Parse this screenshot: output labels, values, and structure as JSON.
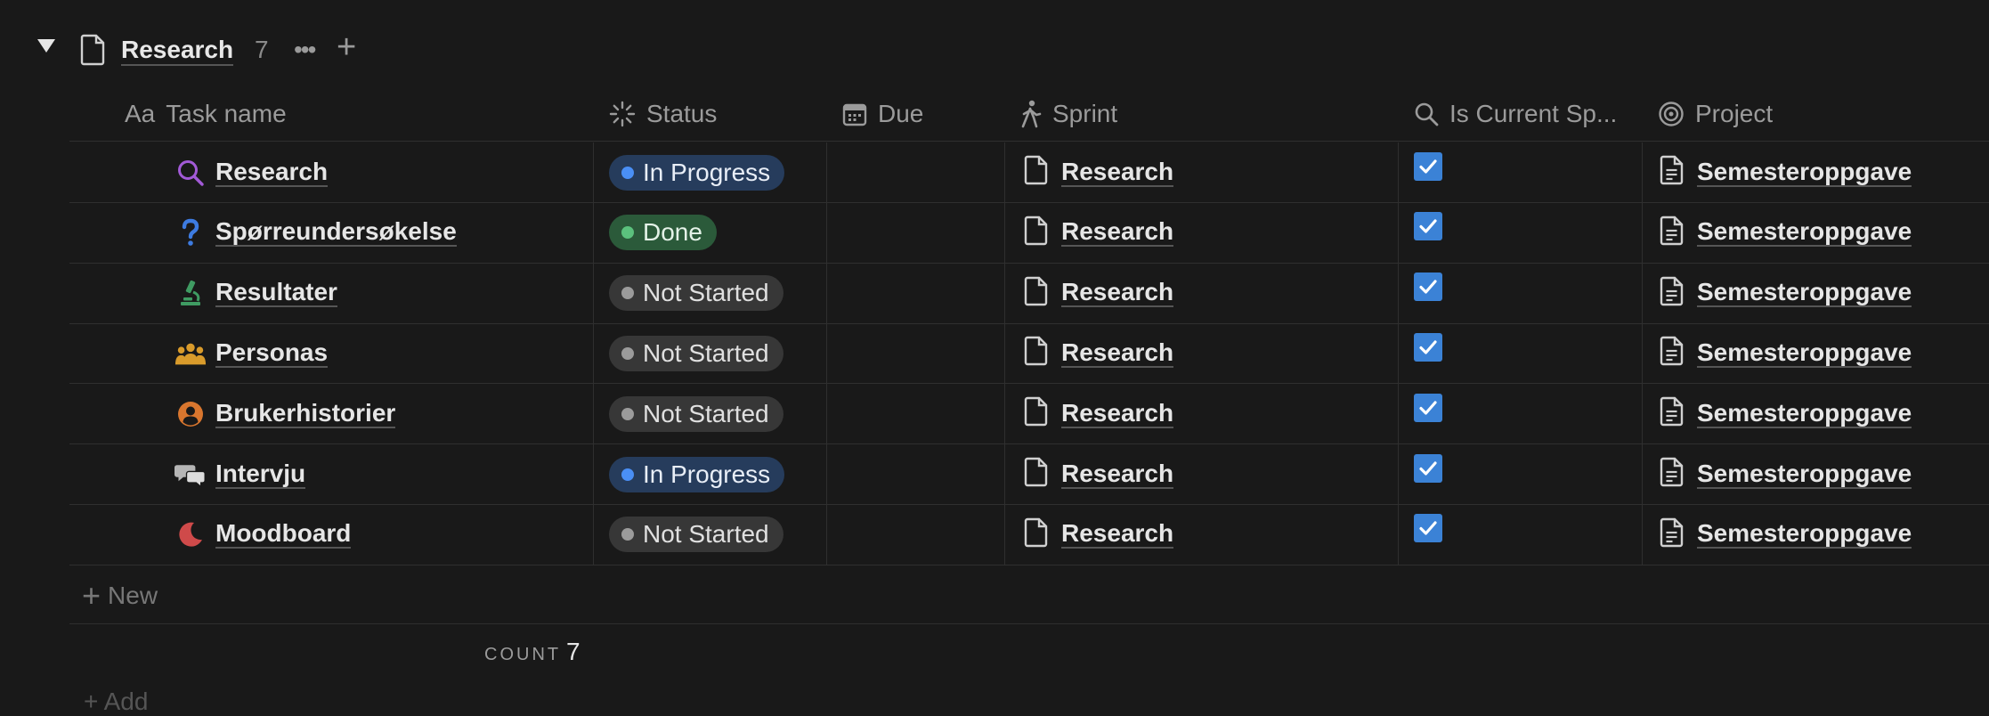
{
  "group": {
    "title": "Research",
    "count": "7",
    "more_glyph": "•••",
    "add_glyph": "+"
  },
  "columns": [
    {
      "icon": "aa-text-icon",
      "icon_text": "Aa",
      "label": "Task name"
    },
    {
      "icon": "status-spinner-icon",
      "label": "Status"
    },
    {
      "icon": "calendar-icon",
      "label": "Due"
    },
    {
      "icon": "walking-person-icon",
      "label": "Sprint"
    },
    {
      "icon": "search-icon",
      "label": "Is Current Sp..."
    },
    {
      "icon": "target-icon",
      "label": "Project"
    }
  ],
  "rows": [
    {
      "name": "Research",
      "icon": "magnifier-icon",
      "status": "In Progress",
      "status_kind": "progress",
      "sprint": "Research",
      "current": true,
      "project": "Semesteroppgave"
    },
    {
      "name": "Spørreundersøkelse",
      "icon": "question-mark-icon",
      "status": "Done",
      "status_kind": "done",
      "sprint": "Research",
      "current": true,
      "project": "Semesteroppgave"
    },
    {
      "name": "Resultater",
      "icon": "microscope-icon",
      "status": "Not Started",
      "status_kind": "notstarted",
      "sprint": "Research",
      "current": true,
      "project": "Semesteroppgave"
    },
    {
      "name": "Personas",
      "icon": "people-group-icon",
      "status": "Not Started",
      "status_kind": "notstarted",
      "sprint": "Research",
      "current": true,
      "project": "Semesteroppgave"
    },
    {
      "name": "Brukerhistorier",
      "icon": "user-circle-icon",
      "status": "Not Started",
      "status_kind": "notstarted",
      "sprint": "Research",
      "current": true,
      "project": "Semesteroppgave"
    },
    {
      "name": "Intervju",
      "icon": "chat-bubbles-icon",
      "status": "In Progress",
      "status_kind": "progress",
      "sprint": "Research",
      "current": true,
      "project": "Semesteroppgave"
    },
    {
      "name": "Moodboard",
      "icon": "moon-icon",
      "status": "Not Started",
      "status_kind": "notstarted",
      "sprint": "Research",
      "current": true,
      "project": "Semesteroppgave"
    }
  ],
  "footer": {
    "new_label": "New",
    "count_label": "COUNT",
    "count_value": "7",
    "add_partial": "+ Add"
  }
}
